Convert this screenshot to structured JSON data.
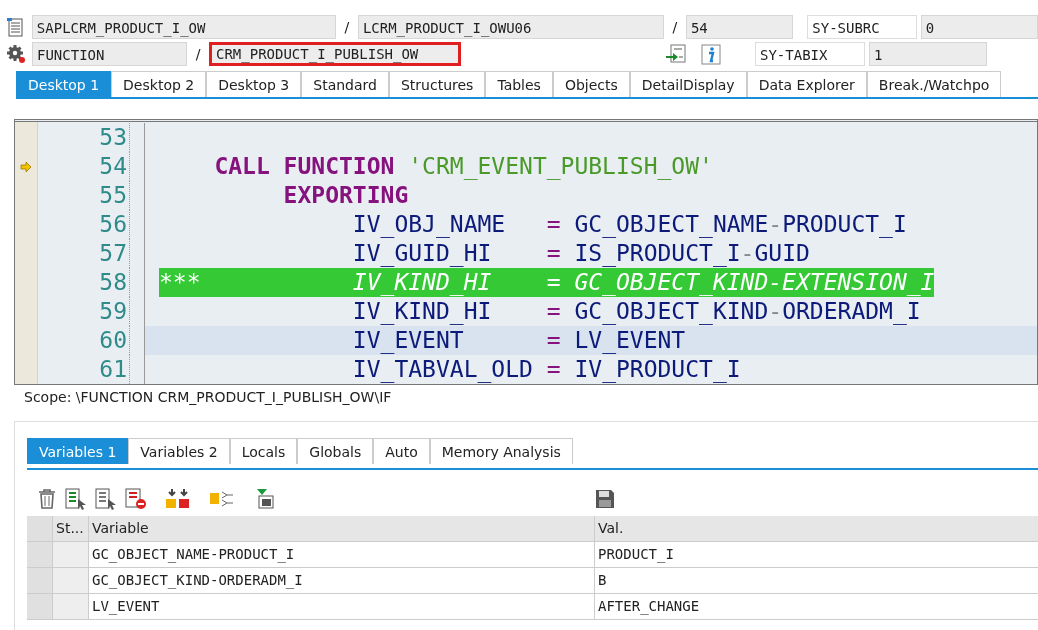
{
  "header": {
    "program": "SAPLCRM_PRODUCT_I_OW",
    "include": "LCRM_PRODUCT_I_OWU06",
    "line": "54",
    "event_type": "FUNCTION",
    "event": "CRM_PRODUCT_I_PUBLISH_OW",
    "event_marked": true,
    "separators": [
      "/",
      "/",
      "/"
    ],
    "system_fields": [
      {
        "label": "SY-SUBRC",
        "value": "0"
      },
      {
        "label": "SY-TABIX",
        "value": "1"
      }
    ]
  },
  "tabs": [
    {
      "label": "Desktop 1",
      "selected": true
    },
    {
      "label": "Desktop 2",
      "selected": false
    },
    {
      "label": "Desktop 3",
      "selected": false
    },
    {
      "label": "Standard",
      "selected": false
    },
    {
      "label": "Structures",
      "selected": false
    },
    {
      "label": "Tables",
      "selected": false
    },
    {
      "label": "Objects",
      "selected": false
    },
    {
      "label": "DetailDisplay",
      "selected": false
    },
    {
      "label": "Data Explorer",
      "selected": false
    },
    {
      "label": "Break./Watchpo",
      "selected": false
    }
  ],
  "editor": {
    "lines": [
      {
        "number": "53",
        "kind": "code",
        "current_statement": false,
        "selected": false
      },
      {
        "number": "54",
        "kind": "code",
        "current_statement": true,
        "selected": false,
        "tokens": [
          {
            "kind": "keyword",
            "text": "    CALL FUNCTION"
          },
          {
            "kind": "string",
            "text": " 'CRM_EVENT_PUBLISH_OW'"
          }
        ]
      },
      {
        "number": "55",
        "kind": "code",
        "current_statement": false,
        "selected": false,
        "tokens": [
          {
            "kind": "keyword",
            "text": "         EXPORTING"
          }
        ]
      },
      {
        "number": "56",
        "kind": "code",
        "current_statement": false,
        "selected": false,
        "tokens": [
          {
            "kind": "ident",
            "text": "              IV_OBJ_NAME   "
          },
          {
            "kind": "op",
            "text": "="
          },
          {
            "kind": "ident",
            "text": " GC_OBJECT_NAME"
          },
          {
            "kind": "dash",
            "text": "-"
          },
          {
            "kind": "ident",
            "text": "PRODUCT_I"
          }
        ]
      },
      {
        "number": "57",
        "kind": "code",
        "current_statement": false,
        "selected": false,
        "tokens": [
          {
            "kind": "ident",
            "text": "              IV_GUID_HI    "
          },
          {
            "kind": "op",
            "text": "="
          },
          {
            "kind": "ident",
            "text": " IS_PRODUCT_I"
          },
          {
            "kind": "dash",
            "text": "-"
          },
          {
            "kind": "ident",
            "text": "GUID"
          }
        ]
      },
      {
        "number": "58",
        "kind": "comment",
        "current_statement": false,
        "selected": false,
        "tokens": [
          {
            "kind": "comment",
            "text": "***           IV_KIND_HI    = GC_OBJECT_KIND-EXTENSION_I"
          }
        ]
      },
      {
        "number": "59",
        "kind": "code",
        "current_statement": false,
        "selected": false,
        "tokens": [
          {
            "kind": "ident",
            "text": "              IV_KIND_HI    "
          },
          {
            "kind": "op",
            "text": "="
          },
          {
            "kind": "ident",
            "text": " GC_OBJECT_KIND"
          },
          {
            "kind": "dash",
            "text": "-"
          },
          {
            "kind": "ident",
            "text": "ORDERADM_I"
          }
        ]
      },
      {
        "number": "60",
        "kind": "code",
        "current_statement": false,
        "selected": true,
        "tokens": [
          {
            "kind": "ident",
            "text": "              IV_EVENT      "
          },
          {
            "kind": "op",
            "text": "="
          },
          {
            "kind": "ident",
            "text": " LV_EVENT"
          }
        ]
      },
      {
        "number": "61",
        "kind": "code",
        "current_statement": false,
        "selected": false,
        "tokens": [
          {
            "kind": "ident",
            "text": "              IV_TABVAL_OLD "
          },
          {
            "kind": "op",
            "text": "="
          },
          {
            "kind": "ident",
            "text": " IV_PRODUCT_I"
          }
        ]
      }
    ]
  },
  "scope": "Scope: \\FUNCTION CRM_PRODUCT_I_PUBLISH_OW\\IF",
  "variable_tabs": [
    {
      "label": "Variables 1",
      "selected": true
    },
    {
      "label": "Variables 2",
      "selected": false
    },
    {
      "label": "Locals",
      "selected": false
    },
    {
      "label": "Globals",
      "selected": false
    },
    {
      "label": "Auto",
      "selected": false
    },
    {
      "label": "Memory Analysis",
      "selected": false
    }
  ],
  "table": {
    "columns": [
      "St...",
      "Variable",
      "Val."
    ],
    "rows": [
      {
        "variable": "GC_OBJECT_NAME-PRODUCT_I",
        "value": "PRODUCT_I"
      },
      {
        "variable": "GC_OBJECT_KIND-ORDERADM_I",
        "value": "B"
      },
      {
        "variable": "LV_EVENT",
        "value": "AFTER_CHANGE"
      }
    ]
  }
}
